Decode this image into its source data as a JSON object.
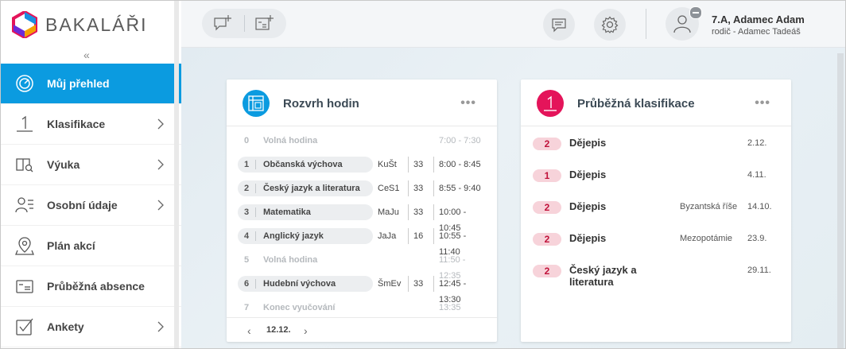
{
  "app": {
    "logo_text": "BAKALÁŘI",
    "collapse_glyph": "«"
  },
  "colors": {
    "accent": "#0b9be0",
    "grade_badge_bg": "#f7d3da",
    "grade_badge_text": "#c0123a",
    "logo_pink": "#e4145a",
    "logo_blue": "#1a8ee0",
    "logo_purple": "#6b2bd8"
  },
  "sidebar": {
    "items": [
      {
        "label": "Můj přehled",
        "icon": "dashboard-gauge-icon",
        "active": true,
        "has_chevron": false
      },
      {
        "label": "Klasifikace",
        "icon": "grade-one-icon",
        "active": false,
        "has_chevron": true
      },
      {
        "label": "Výuka",
        "icon": "book-search-icon",
        "active": false,
        "has_chevron": true
      },
      {
        "label": "Osobní údaje",
        "icon": "person-list-icon",
        "active": false,
        "has_chevron": true
      },
      {
        "label": "Plán akcí",
        "icon": "map-pin-icon",
        "active": false,
        "has_chevron": false
      },
      {
        "label": "Průběžná absence",
        "icon": "absence-card-icon",
        "active": false,
        "has_chevron": false
      },
      {
        "label": "Ankety",
        "icon": "checkbox-icon",
        "active": false,
        "has_chevron": true
      }
    ]
  },
  "topbar": {
    "user_name": "7.A, Adamec Adam",
    "user_role": "rodič - Adamec Tadeáš"
  },
  "schedule": {
    "title": "Rozvrh hodin",
    "more": "•••",
    "date": "12.12.",
    "prev_glyph": "‹",
    "next_glyph": "›",
    "rows": [
      {
        "num": "0",
        "subject": "Volná hodina",
        "teacher": "",
        "room": "",
        "time": "7:00 - 7:30",
        "free": true
      },
      {
        "num": "1",
        "subject": "Občanská výchova",
        "teacher": "KuŠt",
        "room": "33",
        "time": "8:00 - 8:45",
        "free": false
      },
      {
        "num": "2",
        "subject": "Český jazyk a literatura",
        "teacher": "CeS1",
        "room": "33",
        "time": "8:55 - 9:40",
        "free": false
      },
      {
        "num": "3",
        "subject": "Matematika",
        "teacher": "MaJu",
        "room": "33",
        "time": "10:00 - 10:45",
        "free": false
      },
      {
        "num": "4",
        "subject": "Anglický jazyk",
        "teacher": "JaJa",
        "room": "16",
        "time": "10:55 - 11:40",
        "free": false
      },
      {
        "num": "5",
        "subject": "Volná hodina",
        "teacher": "",
        "room": "",
        "time": "11:50 - 12:35",
        "free": true
      },
      {
        "num": "6",
        "subject": "Hudební výchova",
        "teacher": "ŠmEv",
        "room": "33",
        "time": "12:45 - 13:30",
        "free": false
      },
      {
        "num": "7",
        "subject": "Konec vyučování",
        "teacher": "",
        "room": "",
        "time": "13:35",
        "free": true
      }
    ]
  },
  "grades": {
    "title": "Průběžná klasifikace",
    "more": "•••",
    "rows": [
      {
        "grade": "2",
        "subject": "Dějepis",
        "note": "",
        "date": "2.12."
      },
      {
        "grade": "1",
        "subject": "Dějepis",
        "note": "",
        "date": "4.11."
      },
      {
        "grade": "2",
        "subject": "Dějepis",
        "note": "Byzantská říše",
        "date": "14.10."
      },
      {
        "grade": "2",
        "subject": "Dějepis",
        "note": "Mezopotámie",
        "date": "23.9."
      },
      {
        "grade": "2",
        "subject": "Český jazyk a literatura",
        "note": "",
        "date": "29.11."
      }
    ]
  }
}
